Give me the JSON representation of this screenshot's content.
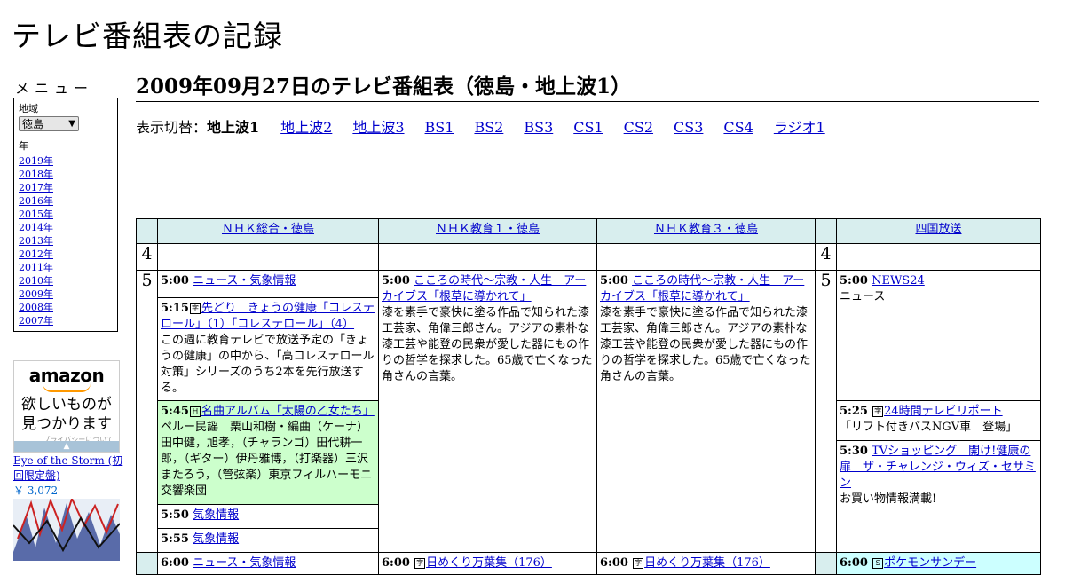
{
  "site_title": "テレビ番組表の記録",
  "menu": {
    "title": "メニュー",
    "region_label": "地域",
    "region_value": "徳島",
    "year_label": "年",
    "years": [
      "2019年",
      "2018年",
      "2017年",
      "2016年",
      "2015年",
      "2014年",
      "2013年",
      "2012年",
      "2011年",
      "2010年",
      "2009年",
      "2008年",
      "2007年"
    ]
  },
  "ad": {
    "logo": "amazon",
    "copy_line1": "欲しいものが",
    "copy_line2": "見つかります",
    "privacy": "プライバシーについて",
    "product_title": "Eye of the Storm (初回限定盤)",
    "product_price": "￥ 3,072"
  },
  "page_heading": "2009年09月27日のテレビ番組表（徳島・地上波1）",
  "switcher": {
    "label": "表示切替：",
    "current": "地上波1",
    "links": [
      "地上波2",
      "地上波3",
      "BS1",
      "BS2",
      "BS3",
      "CS1",
      "CS2",
      "CS3",
      "CS4",
      "ラジオ1"
    ]
  },
  "channels": [
    "ＮＨＫ総合・徳島",
    "ＮＨＫ教育１・徳島",
    "ＮＨＫ教育３・徳島",
    "四国放送"
  ],
  "hours": [
    "4",
    "5",
    "5"
  ],
  "programs": {
    "nhk_g": [
      {
        "time": "5:00",
        "title": "ニュース・気象情報",
        "desc": ""
      },
      {
        "time": "5:15",
        "icon": "字",
        "title": "先どり　きょうの健康「コレステロール」（1）「コレステロール」（4）",
        "desc": "この週に教育テレビで放送予定の「きょうの健康」の中から、「高コレステロール対策」シリーズのうち2本を先行放送する。"
      },
      {
        "time": "5:45",
        "icon": "Ｈ",
        "title": "名曲アルバム「太陽の乙女たち」",
        "desc": "ペルー民謡　栗山和樹・編曲（ケーナ）田中健，旭孝，（チャランゴ）田代耕一郎，（ギター）伊丹雅博，（打楽器）三沢またろう，（管弦楽）東京フィルハーモニ交響楽団"
      },
      {
        "time": "5:50",
        "title": "気象情報",
        "desc": ""
      },
      {
        "time": "5:55",
        "title": "気象情報",
        "desc": ""
      },
      {
        "time": "6:00",
        "title": "ニュース・気象情報",
        "desc": ""
      }
    ],
    "nhk_e1": [
      {
        "time": "5:00",
        "title": "こころの時代～宗教・人生　アーカイブス「根草に導かれて」",
        "desc": "漆を素手で豪快に塗る作品で知られた漆工芸家、角偉三郎さん。アジアの素朴な漆工芸や能登の民衆が愛した器にもの作りの哲学を探求した。65歳で亡くなった角さんの言葉。"
      },
      {
        "time": "6:00",
        "icon": "字",
        "title": "日めくり万葉集（176）",
        "desc": ""
      }
    ],
    "nhk_e3": [
      {
        "time": "5:00",
        "title": "こころの時代～宗教・人生　アーカイブス「根草に導かれて」",
        "desc": "漆を素手で豪快に塗る作品で知られた漆工芸家、角偉三郎さん。アジアの素朴な漆工芸や能登の民衆が愛した器にもの作りの哲学を探求した。65歳で亡くなった角さんの言葉。"
      },
      {
        "time": "6:00",
        "icon": "字",
        "title": "日めくり万葉集（176）",
        "desc": ""
      }
    ],
    "jrt": [
      {
        "time": "5:00",
        "title": "NEWS24",
        "desc": "ニュース"
      },
      {
        "time": "5:25",
        "icon": "字",
        "title": "24時間テレビリポート",
        "desc": "「リフト付きバスNGV車　登場」"
      },
      {
        "time": "5:30",
        "title": "TVショッピング　開け!健康の扉　ザ・チャレンジ・ウィズ・セサミン",
        "desc": "お買い物情報満載!"
      },
      {
        "time": "6:00",
        "icon": "Ｓ",
        "title": "ポケモンサンデー",
        "desc": ""
      }
    ]
  }
}
